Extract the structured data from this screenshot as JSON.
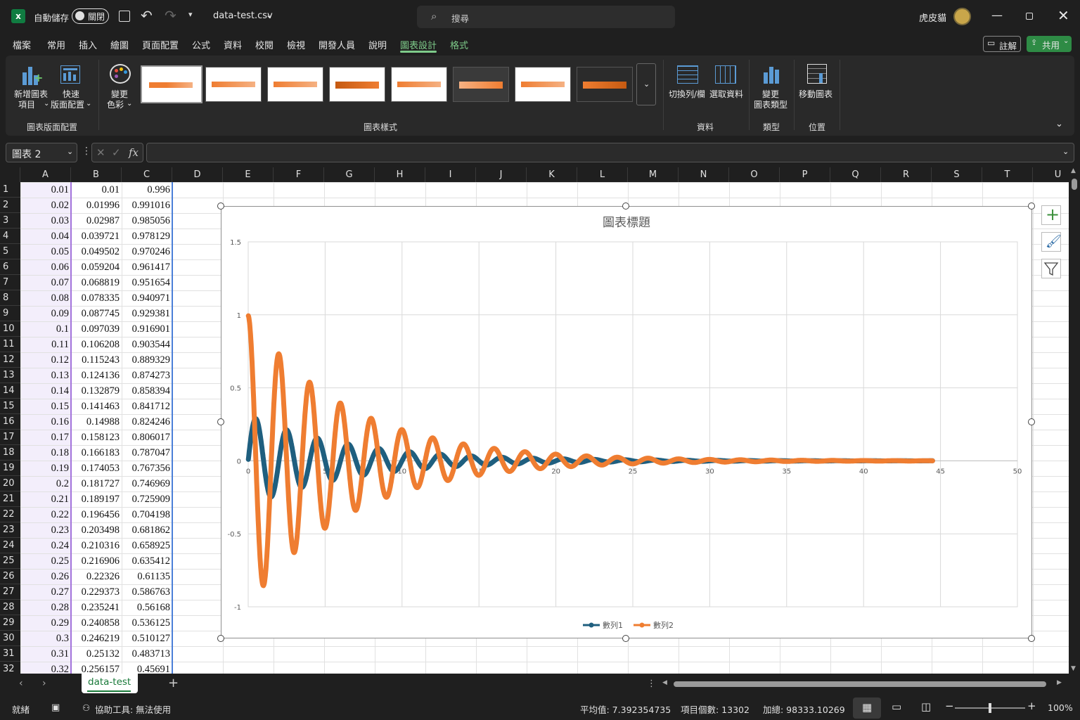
{
  "title_bar": {
    "autosave_label": "自動儲存",
    "autosave_state": "關閉",
    "filename": "data-test.csv",
    "search_placeholder": "搜尋",
    "user_name": "虎皮貓"
  },
  "tabs": [
    "檔案",
    "常用",
    "插入",
    "繪圖",
    "頁面配置",
    "公式",
    "資料",
    "校閱",
    "檢視",
    "開發人員",
    "說明",
    "圖表設計",
    "格式"
  ],
  "tabs_extra": {
    "comment": "註解",
    "share": "共用"
  },
  "ribbon": {
    "add_element_l1": "新增圖表",
    "add_element_l2": "項目",
    "quick_layout_l1": "快速",
    "quick_layout_l2": "版面配置",
    "change_colors_l1": "變更",
    "change_colors_l2": "色彩",
    "group_layout": "圖表版面配置",
    "group_styles": "圖表樣式",
    "switch_rowcol": "切換列/欄",
    "select_data": "選取資料",
    "group_data": "資料",
    "change_type_l1": "變更",
    "change_type_l2": "圖表類型",
    "group_type": "類型",
    "move_chart": "移動圖表",
    "group_location": "位置"
  },
  "formula_bar": {
    "name_box": "圖表 2",
    "fx": "fx",
    "formula": ""
  },
  "columns": [
    "A",
    "B",
    "C",
    "D",
    "E",
    "F",
    "G",
    "H",
    "I",
    "J",
    "K",
    "L",
    "M",
    "N",
    "O",
    "P",
    "Q",
    "R",
    "S",
    "T",
    "U"
  ],
  "rows": [
    [
      "1",
      "0.01",
      "0.01",
      "0.996"
    ],
    [
      "2",
      "0.02",
      "0.01996",
      "0.991016"
    ],
    [
      "3",
      "0.03",
      "0.02987",
      "0.985056"
    ],
    [
      "4",
      "0.04",
      "0.039721",
      "0.978129"
    ],
    [
      "5",
      "0.05",
      "0.049502",
      "0.970246"
    ],
    [
      "6",
      "0.06",
      "0.059204",
      "0.961417"
    ],
    [
      "7",
      "0.07",
      "0.068819",
      "0.951654"
    ],
    [
      "8",
      "0.08",
      "0.078335",
      "0.940971"
    ],
    [
      "9",
      "0.09",
      "0.087745",
      "0.929381"
    ],
    [
      "10",
      "0.1",
      "0.097039",
      "0.916901"
    ],
    [
      "11",
      "0.11",
      "0.106208",
      "0.903544"
    ],
    [
      "12",
      "0.12",
      "0.115243",
      "0.889329"
    ],
    [
      "13",
      "0.13",
      "0.124136",
      "0.874273"
    ],
    [
      "14",
      "0.14",
      "0.132879",
      "0.858394"
    ],
    [
      "15",
      "0.15",
      "0.141463",
      "0.841712"
    ],
    [
      "16",
      "0.16",
      "0.14988",
      "0.824246"
    ],
    [
      "17",
      "0.17",
      "0.158123",
      "0.806017"
    ],
    [
      "18",
      "0.18",
      "0.166183",
      "0.787047"
    ],
    [
      "19",
      "0.19",
      "0.174053",
      "0.767356"
    ],
    [
      "20",
      "0.2",
      "0.181727",
      "0.746969"
    ],
    [
      "21",
      "0.21",
      "0.189197",
      "0.725909"
    ],
    [
      "22",
      "0.22",
      "0.196456",
      "0.704198"
    ],
    [
      "23",
      "0.23",
      "0.203498",
      "0.681862"
    ],
    [
      "24",
      "0.24",
      "0.210316",
      "0.658925"
    ],
    [
      "25",
      "0.25",
      "0.216906",
      "0.635412"
    ],
    [
      "26",
      "0.26",
      "0.22326",
      "0.61135"
    ],
    [
      "27",
      "0.27",
      "0.229373",
      "0.586763"
    ],
    [
      "28",
      "0.28",
      "0.235241",
      "0.56168"
    ],
    [
      "29",
      "0.29",
      "0.240858",
      "0.536125"
    ],
    [
      "30",
      "0.3",
      "0.246219",
      "0.510127"
    ],
    [
      "31",
      "0.31",
      "0.25132",
      "0.483713"
    ],
    [
      "32",
      "0.32",
      "0.256157",
      "0.45691"
    ]
  ],
  "chart_data": {
    "type": "scatter",
    "title": "圖表標題",
    "xlim": [
      0,
      50
    ],
    "ylim": [
      -1,
      1.5
    ],
    "xticks": [
      "0",
      "5",
      "10",
      "15",
      "20",
      "25",
      "30",
      "35",
      "40",
      "45",
      "50"
    ],
    "yticks": [
      "1.5",
      "1",
      "0.5",
      "0",
      "-0.5",
      "-1"
    ],
    "x_range_of_data": [
      0.01,
      44.5
    ],
    "grid": true,
    "legend": "bottom",
    "series": [
      {
        "name": "數列1",
        "color": "#1f5f7f",
        "amplitude_peak": 0.3,
        "period": 2.0,
        "phase": "sine"
      },
      {
        "name": "數列2",
        "color": "#ef7d31",
        "amplitude_peak": 0.996,
        "period": 2.0,
        "phase": "cosine"
      }
    ]
  },
  "sheet_tabs": {
    "active": "data-test",
    "add": "+"
  },
  "status": {
    "ready": "就緒",
    "accessibility": "協助工具: 無法使用",
    "average": "平均值: 7.392354735",
    "count": "項目個數: 13302",
    "sum": "加總: 98333.10269",
    "zoom": "100%"
  },
  "colors": {
    "accent_green": "#7ecb8a",
    "series1": "#1f5f7f",
    "series2": "#ef7d31",
    "selection_purple": "#f3eefb"
  }
}
